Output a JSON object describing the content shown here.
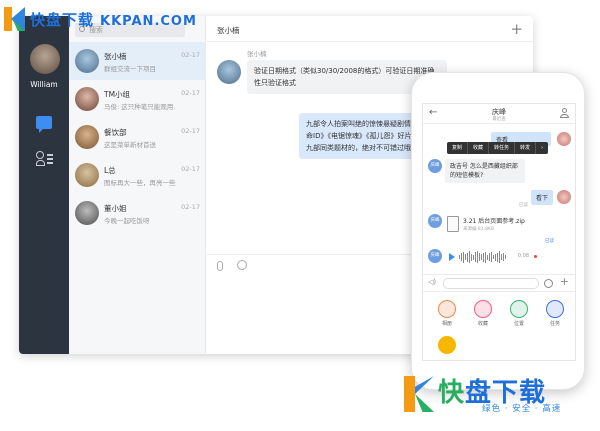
{
  "watermark": {
    "top_brand": "快盘下载",
    "top_site": "KKPAN.COM",
    "bottom_big_a": "快",
    "bottom_big_b": "盘下载",
    "bottom_slogan": "绿色 · 安全 · 高速"
  },
  "rail": {
    "username": "William"
  },
  "list": {
    "search_placeholder": "搜索",
    "conversations": [
      {
        "name": "张小楠",
        "preview": "群组交流一下项目",
        "date": "02-17",
        "active": true
      },
      {
        "name": "TM小组",
        "preview": "马俊: 这只种笔只能观用...",
        "date": "02-17",
        "active": false
      },
      {
        "name": "餐饮部",
        "preview": "这是菜单新材首送",
        "date": "02-17",
        "active": false
      },
      {
        "name": "L总",
        "preview": "图标再大一些，再亮一些些",
        "date": "02-17",
        "active": false
      },
      {
        "name": "董小姐",
        "preview": "今晚一起吃饭呀",
        "date": "02-17",
        "active": false
      }
    ]
  },
  "chat": {
    "header_title": "张小楠",
    "plus_icon": "+",
    "sender_name": "张小楠",
    "msg_left": "验证日期格式（类似30/30/2008的格式）可验证日期准确性只验证格式",
    "msg_right": "九部令人拍案叫绝的惊悚悬疑剧情片：《禁闭岛》《致命ID》《电锯惊魂》《孤儿怨》好片，那么接下来推荐九部同类题材的，绝对不可错过哦"
  },
  "phone": {
    "title": "庆峰",
    "subtitle": "最近查",
    "ctx_menu": [
      "复制",
      "收藏",
      "转任务",
      "转发",
      "›"
    ],
    "bubble_top_right": "查看",
    "avatar_label": "庆峰",
    "msg_left": "政吉号 怎么是西藏组织部的短信模板?",
    "bubble_right": "看下",
    "read_1": "已读",
    "read_2": "已读",
    "file_name": "3.21 后台页面参考.zip",
    "file_size": "来源编  81.8KB",
    "voice_duration": "0:08",
    "actions": [
      {
        "label": "相册",
        "color": "#f0894d"
      },
      {
        "label": "收藏",
        "color": "#f05d84"
      },
      {
        "label": "位置",
        "color": "#3bb273"
      },
      {
        "label": "任务",
        "color": "#3d6fe0"
      }
    ],
    "extra_action_color": "#f5b700"
  }
}
